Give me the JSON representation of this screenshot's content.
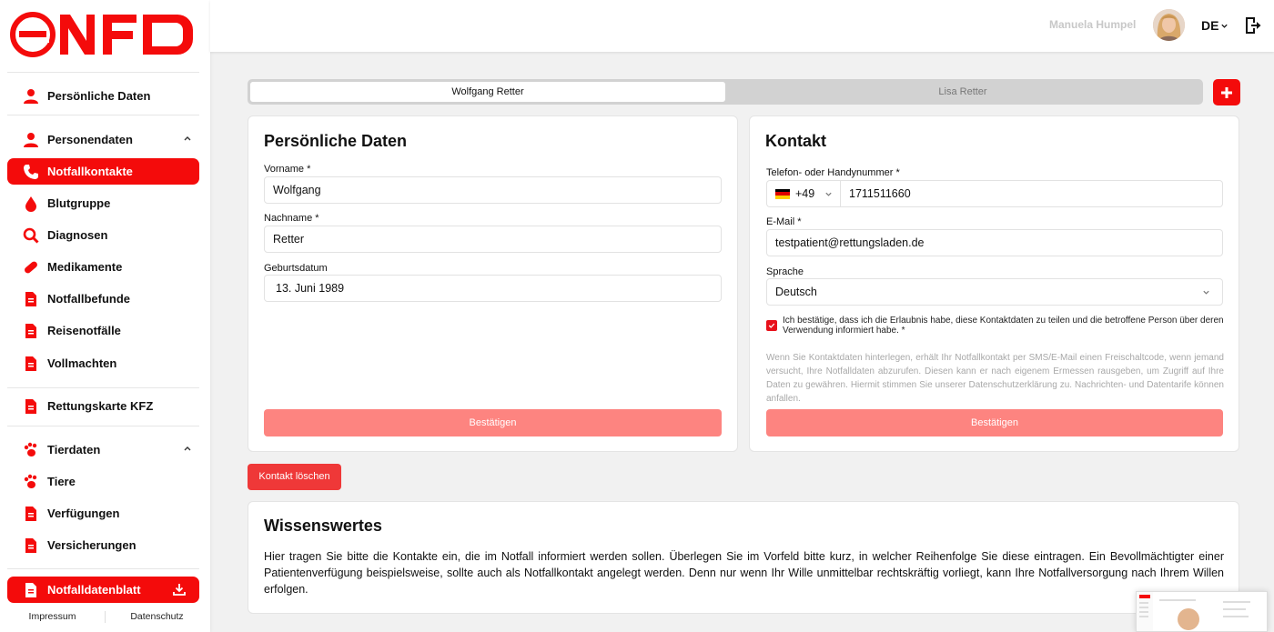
{
  "brand": {
    "accent": "#f40b0b",
    "confirm": "#fd8480",
    "delete": "#ef3838"
  },
  "sidebar": {
    "items": [
      {
        "label": "Persönliche Daten",
        "icon": "person-icon"
      },
      {
        "label": "Personendaten",
        "icon": "person-icon"
      },
      {
        "label": "Notfallkontakte",
        "icon": "phone-icon",
        "active": true
      },
      {
        "label": "Blutgruppe",
        "icon": "blood-drop-icon"
      },
      {
        "label": "Diagnosen",
        "icon": "magnifier-icon"
      },
      {
        "label": "Medikamente",
        "icon": "pill-icon"
      },
      {
        "label": "Notfallbefunde",
        "icon": "document-icon"
      },
      {
        "label": "Reisenotfälle",
        "icon": "document-icon"
      },
      {
        "label": "Vollmachten",
        "icon": "document-icon"
      },
      {
        "label": "Rettungskarte KFZ",
        "icon": "document-icon"
      },
      {
        "label": "Tierdaten",
        "icon": "paw-icon"
      },
      {
        "label": "Tiere",
        "icon": "paw-icon"
      },
      {
        "label": "Verfügungen",
        "icon": "document-icon"
      },
      {
        "label": "Versicherungen",
        "icon": "document-icon"
      },
      {
        "label": "Notfalldatenblatt",
        "icon": "document-icon"
      }
    ],
    "footer": {
      "impressum": "Impressum",
      "datenschutz": "Datenschutz"
    }
  },
  "topbar": {
    "username": "Manuela Humpel",
    "language": "DE"
  },
  "tabs": [
    {
      "label": "Wolfgang Retter"
    },
    {
      "label": "Lisa Retter"
    }
  ],
  "personal": {
    "title": "Persönliche Daten",
    "vorname_label": "Vorname *",
    "vorname_value": "Wolfgang",
    "nachname_label": "Nachname *",
    "nachname_value": "Retter",
    "geburtsdatum_label": "Geburtsdatum",
    "geburtsdatum_value": "13. Juni 1989",
    "confirm_label": "Bestätigen"
  },
  "contact": {
    "title": "Kontakt",
    "phone_label": "Telefon- oder Handynummer *",
    "phone_prefix": "+49",
    "phone_value": "1711511660",
    "email_label": "E-Mail *",
    "email_value": "testpatient@rettungsladen.de",
    "language_label": "Sprache",
    "language_value": "Deutsch",
    "consent_text": "Ich bestätige, dass ich die Erlaubnis habe, diese Kontaktdaten zu teilen und die betroffene Person über deren Verwendung informiert habe. *",
    "info_text": "Wenn Sie Kontaktdaten hinterlegen, erhält Ihr Notfallkontakt per SMS/E-Mail einen Freischaltcode, wenn jemand versucht, Ihre Notfalldaten abzurufen. Diesen kann er nach eigenem Ermessen rausgeben, um Zugriff auf Ihre Daten zu gewähren. Hiermit stimmen Sie unserer Datenschutzerklärung zu. Nachrichten- und Datentarife können anfallen.",
    "confirm_label": "Bestätigen"
  },
  "delete_label": "Kontakt löschen",
  "wissenswertes": {
    "title": "Wissenswertes",
    "text": "Hier tragen Sie bitte die Kontakte ein, die im Notfall informiert werden sollen. Überlegen Sie im Vorfeld bitte kurz, in welcher Reihenfolge Sie diese eintragen. Ein Bevollmächtigter einer Patientenverfügung beispielsweise, sollte auch als Notfallkontakt angelegt werden. Denn nur wenn Ihr Wille unmittelbar rechtskräftig vorliegt, kann Ihre Notfallversorgung nach Ihrem Willen erfolgen."
  }
}
